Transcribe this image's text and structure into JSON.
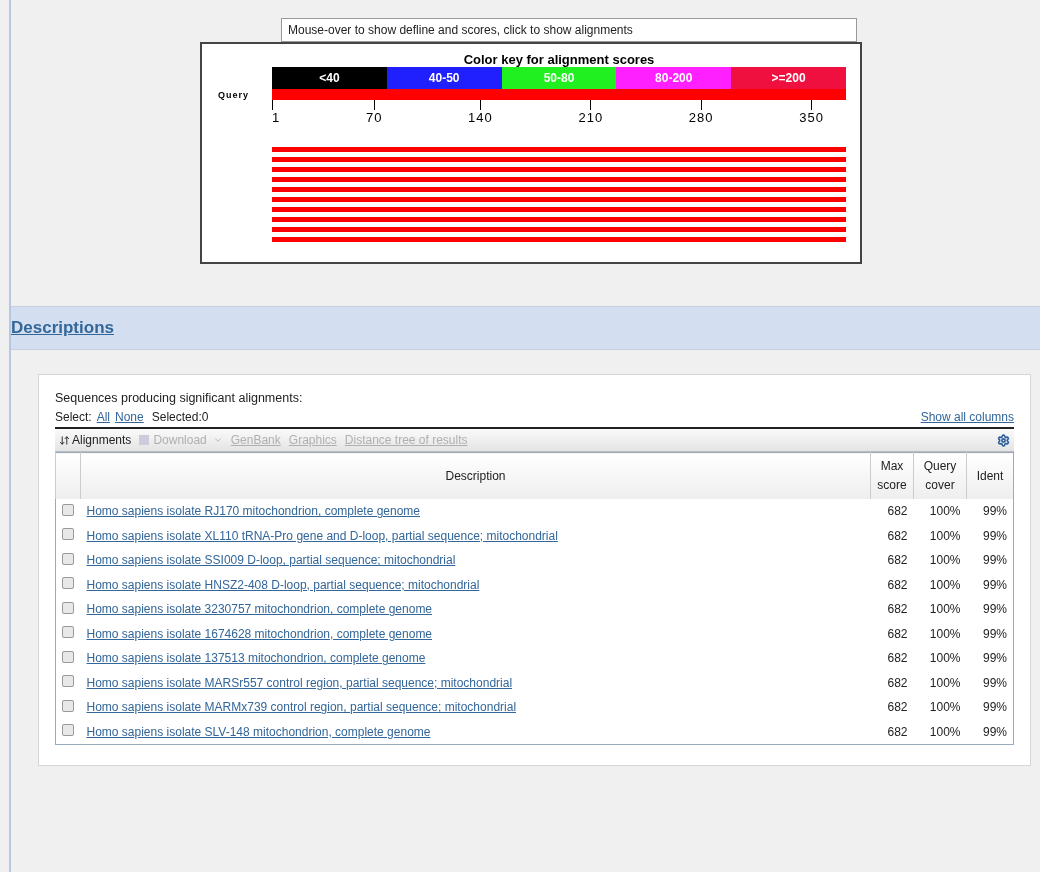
{
  "graphic": {
    "hint": "Mouse-over to show defline and scores, click to show alignments",
    "key_title": "Color key for alignment scores",
    "color_key": [
      {
        "label": "<40",
        "color": "#000000"
      },
      {
        "label": "40-50",
        "color": "#2020ff"
      },
      {
        "label": "50-80",
        "color": "#20f020"
      },
      {
        "label": "80-200",
        "color": "#ff20ff"
      },
      {
        "label": ">=200",
        "color": "#f01040"
      }
    ],
    "query_label": "Query",
    "axis_ticks": [
      "1",
      "70",
      "140",
      "210",
      "280",
      "350"
    ],
    "hits": [
      {
        "color": "#ff0000"
      },
      {
        "color": "#ff0000"
      },
      {
        "color": "#ff0000"
      },
      {
        "color": "#ff0000"
      },
      {
        "color": "#ff0000"
      },
      {
        "color": "#ff0000"
      },
      {
        "color": "#ff0000"
      },
      {
        "color": "#ff0000"
      },
      {
        "color": "#ff0000"
      },
      {
        "color": "#ff0000"
      }
    ]
  },
  "section": {
    "title": "Descriptions"
  },
  "results": {
    "heading": "Sequences producing significant alignments:",
    "select_label": "Select:",
    "select_all": "All",
    "select_none": "None",
    "selected_count": "Selected:0",
    "show_all_columns": "Show all columns",
    "toolbar": [
      {
        "label": "Alignments",
        "disabled": false,
        "kind": "sort"
      },
      {
        "label": "Download",
        "disabled": true,
        "kind": "menu"
      },
      {
        "label": "GenBank",
        "disabled": true,
        "kind": "link"
      },
      {
        "label": "Graphics",
        "disabled": true,
        "kind": "link"
      },
      {
        "label": "Distance tree of results",
        "disabled": true,
        "kind": "link"
      }
    ],
    "columns": [
      "Description",
      "Max score",
      "Query cover",
      "Ident"
    ],
    "rows": [
      {
        "checked": false,
        "description": "Homo sapiens isolate RJ170 mitochondrion, complete genome",
        "max_score": "682",
        "query_cover": "100%",
        "ident": "99%"
      },
      {
        "checked": false,
        "description": "Homo sapiens isolate XL110 tRNA-Pro gene and D-loop, partial sequence; mitochondrial",
        "max_score": "682",
        "query_cover": "100%",
        "ident": "99%"
      },
      {
        "checked": false,
        "description": "Homo sapiens isolate SSI009 D-loop, partial sequence; mitochondrial",
        "max_score": "682",
        "query_cover": "100%",
        "ident": "99%"
      },
      {
        "checked": false,
        "description": "Homo sapiens isolate HNSZ2-408 D-loop, partial sequence; mitochondrial",
        "max_score": "682",
        "query_cover": "100%",
        "ident": "99%"
      },
      {
        "checked": false,
        "description": "Homo sapiens isolate 3230757 mitochondrion, complete genome",
        "max_score": "682",
        "query_cover": "100%",
        "ident": "99%"
      },
      {
        "checked": false,
        "description": "Homo sapiens isolate 1674628 mitochondrion, complete genome",
        "max_score": "682",
        "query_cover": "100%",
        "ident": "99%"
      },
      {
        "checked": false,
        "description": "Homo sapiens isolate 137513 mitochondrion, complete genome",
        "max_score": "682",
        "query_cover": "100%",
        "ident": "99%"
      },
      {
        "checked": false,
        "description": "Homo sapiens isolate MARSr557 control region, partial sequence; mitochondrial",
        "max_score": "682",
        "query_cover": "100%",
        "ident": "99%"
      },
      {
        "checked": false,
        "description": "Homo sapiens isolate MARMx739 control region, partial sequence; mitochondrial",
        "max_score": "682",
        "query_cover": "100%",
        "ident": "99%"
      },
      {
        "checked": false,
        "description": "Homo sapiens isolate SLV-148 mitochondrion, complete genome",
        "max_score": "682",
        "query_cover": "100%",
        "ident": "99%"
      }
    ]
  }
}
